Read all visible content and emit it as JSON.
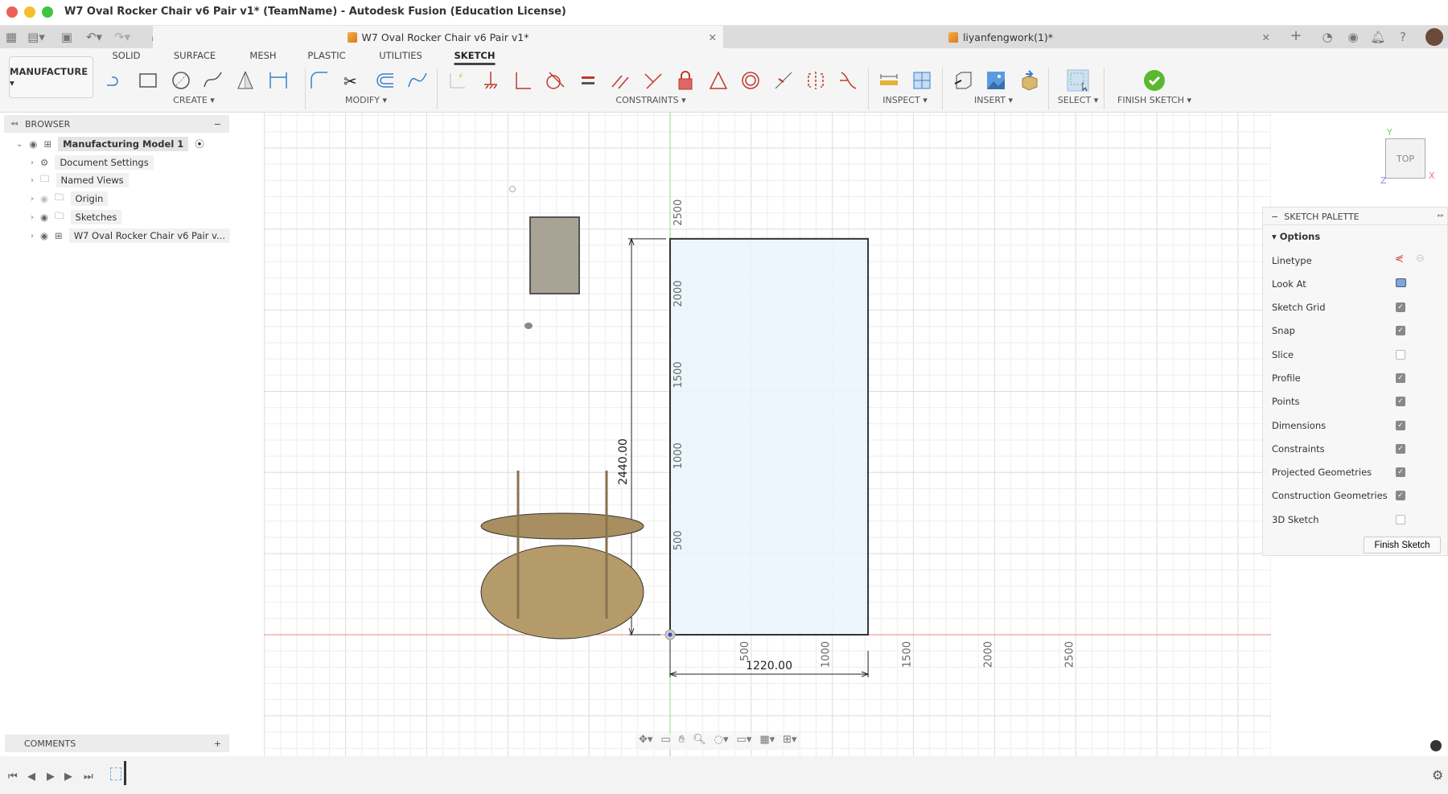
{
  "window": {
    "title": "W7 Oval Rocker Chair v6 Pair v1* (TeamName) - Autodesk Fusion (Education License)"
  },
  "tabs": [
    {
      "label": "W7 Oval Rocker Chair v6 Pair v1*"
    },
    {
      "label": "liyanfengwork(1)*"
    }
  ],
  "ribbon": {
    "workspace": "MANUFACTURE ▾",
    "tabs": [
      "SOLID",
      "SURFACE",
      "MESH",
      "PLASTIC",
      "UTILITIES",
      "SKETCH"
    ],
    "active_tab": "SKETCH",
    "groups": [
      {
        "label": "CREATE ▾",
        "tools": [
          "line",
          "rectangle",
          "circle",
          "spline",
          "triangle-mirror",
          "dimension-line"
        ]
      },
      {
        "label": "MODIFY ▾",
        "tools": [
          "fillet",
          "trim",
          "offset",
          "curve"
        ]
      },
      {
        "label": "CONSTRAINTS ▾",
        "tools": [
          "auto-constrain",
          "ground",
          "coincident",
          "tangent",
          "equal",
          "parallel",
          "perpendicular",
          "fix",
          "triangle",
          "concentric",
          "midpoint",
          "symmetry",
          "curvature"
        ]
      },
      {
        "label": "INSPECT ▾",
        "tools": [
          "measure",
          "interference"
        ]
      },
      {
        "label": "INSERT ▾",
        "tools": [
          "insert-derive",
          "insert-image",
          "insert-mesh"
        ]
      },
      {
        "label": "SELECT ▾",
        "tools": [
          "select"
        ]
      },
      {
        "label": "FINISH SKETCH ▾",
        "tools": [
          "finish-check"
        ]
      }
    ]
  },
  "browser": {
    "title": "BROWSER",
    "items": [
      {
        "label": "Manufacturing Model 1",
        "icon": "component"
      },
      {
        "label": "Document Settings",
        "icon": "gear"
      },
      {
        "label": "Named Views",
        "icon": "folder"
      },
      {
        "label": "Origin",
        "icon": "folder"
      },
      {
        "label": "Sketches",
        "icon": "folder"
      },
      {
        "label": "W7 Oval Rocker Chair v6 Pair v...",
        " icon": "component"
      }
    ]
  },
  "comments": {
    "title": "COMMENTS"
  },
  "viewcube": {
    "face": "TOP",
    "x": "X",
    "y": "Y",
    "z": "Z"
  },
  "sketch": {
    "width_dim": "1220.00",
    "height_dim": "2440.00",
    "width_mm": 1220,
    "height_mm": 2440,
    "x_ticks": [
      "500",
      "1000",
      "1500",
      "2000",
      "2500"
    ],
    "y_ticks": [
      "500",
      "1000",
      "1500",
      "2000",
      "2500"
    ]
  },
  "palette": {
    "title": "SKETCH PALETTE",
    "section": "Options",
    "linetype": "Linetype",
    "look_at": "Look At",
    "options": [
      {
        "label": "Sketch Grid",
        "checked": true
      },
      {
        "label": "Snap",
        "checked": true
      },
      {
        "label": "Slice",
        "checked": false
      },
      {
        "label": "Profile",
        "checked": true
      },
      {
        "label": "Points",
        "checked": true
      },
      {
        "label": "Dimensions",
        "checked": true
      },
      {
        "label": "Constraints",
        "checked": true
      },
      {
        "label": "Projected Geometries",
        "checked": true
      },
      {
        "label": "Construction Geometries",
        "checked": true
      },
      {
        "label": "3D Sketch",
        "checked": false
      }
    ],
    "finish": "Finish Sketch"
  },
  "colors": {
    "accent": "#4a8fd6",
    "constraint": "#c0392b",
    "finish": "#5cb82e",
    "x_axis": "#e88",
    "y_axis": "#8d8"
  }
}
